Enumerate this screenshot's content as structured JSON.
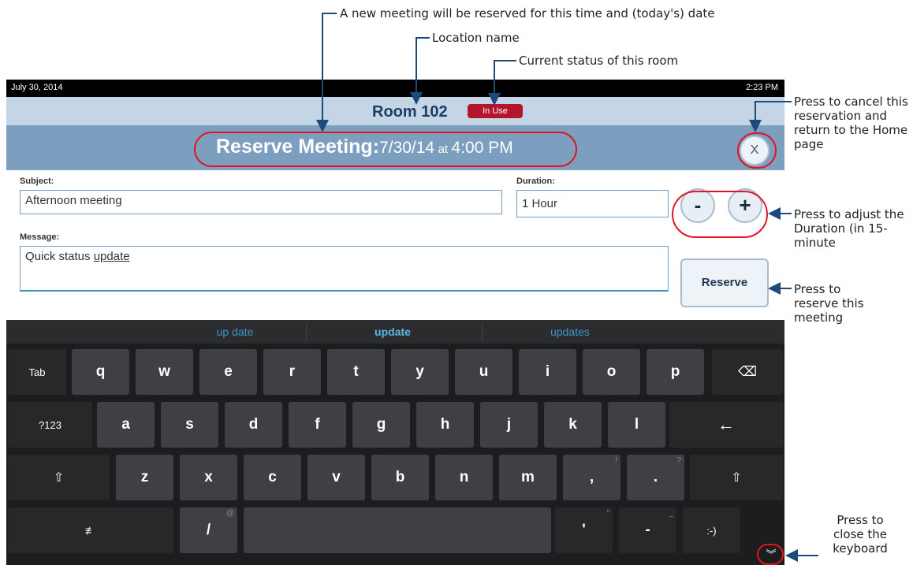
{
  "callouts": {
    "new_meeting": "A new meeting will be reserved for this time and (today's) date",
    "location": "Location name",
    "status": "Current status of this room",
    "cancel": "Press to cancel this reservation and return to the Home page",
    "adjust": "Press to adjust the Duration (in 15-minute",
    "reserve": "Press to reserve this meeting",
    "close_kb": "Press to close the keyboard"
  },
  "statusbar": {
    "date": "July 30, 2014",
    "time": "2:23 PM"
  },
  "room": {
    "name": "Room 102",
    "status": "In Use"
  },
  "title": {
    "main": "Reserve Meeting:",
    "date": "7/30/14",
    "at": "at",
    "time": "4:00 PM",
    "cancel_label": "X"
  },
  "form": {
    "subject_label": "Subject:",
    "subject_value": "Afternoon meeting",
    "duration_label": "Duration:",
    "duration_value": "1 Hour",
    "minus_label": "-",
    "plus_label": "+",
    "message_label": "Message:",
    "message_prefix": "Quick status ",
    "message_word": "update",
    "reserve_label": "Reserve"
  },
  "keyboard": {
    "suggestions": [
      "up date",
      "update",
      "updates"
    ],
    "row1": [
      "Tab",
      "q",
      "w",
      "e",
      "r",
      "t",
      "y",
      "u",
      "i",
      "o",
      "p",
      "⌫"
    ],
    "row2": [
      "?123",
      "a",
      "s",
      "d",
      "f",
      "g",
      "h",
      "j",
      "k",
      "l",
      "←"
    ],
    "row3": [
      "⇧",
      "z",
      "x",
      "c",
      "v",
      "b",
      "n",
      "m",
      ",",
      ".",
      "⇧"
    ],
    "row4": [
      "≢",
      "/",
      "",
      "'",
      "-",
      ":-)",
      "︾"
    ],
    "hints": {
      "comma": "!",
      "period": "?",
      "slash": "@",
      "apos": "\"",
      "dash": "_"
    }
  },
  "colors": {
    "accent_red": "#e0151f",
    "arrow_blue": "#1d4a7a",
    "title_bar": "#7c9fbf",
    "room_bar": "#c4d6e5"
  }
}
